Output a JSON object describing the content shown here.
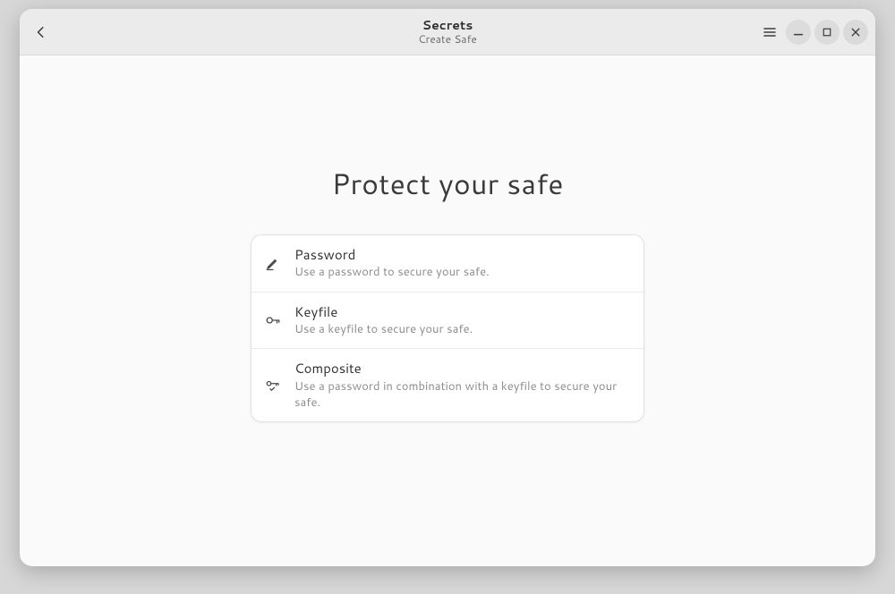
{
  "header": {
    "title": "Secrets",
    "subtitle": "Create Safe"
  },
  "page": {
    "heading": "Protect your safe"
  },
  "options": {
    "password": {
      "title": "Password",
      "desc": "Use a password to secure your safe."
    },
    "keyfile": {
      "title": "Keyfile",
      "desc": "Use a keyfile to secure your safe."
    },
    "composite": {
      "title": "Composite",
      "desc": "Use a password in combination with a keyfile to secure your safe."
    }
  }
}
